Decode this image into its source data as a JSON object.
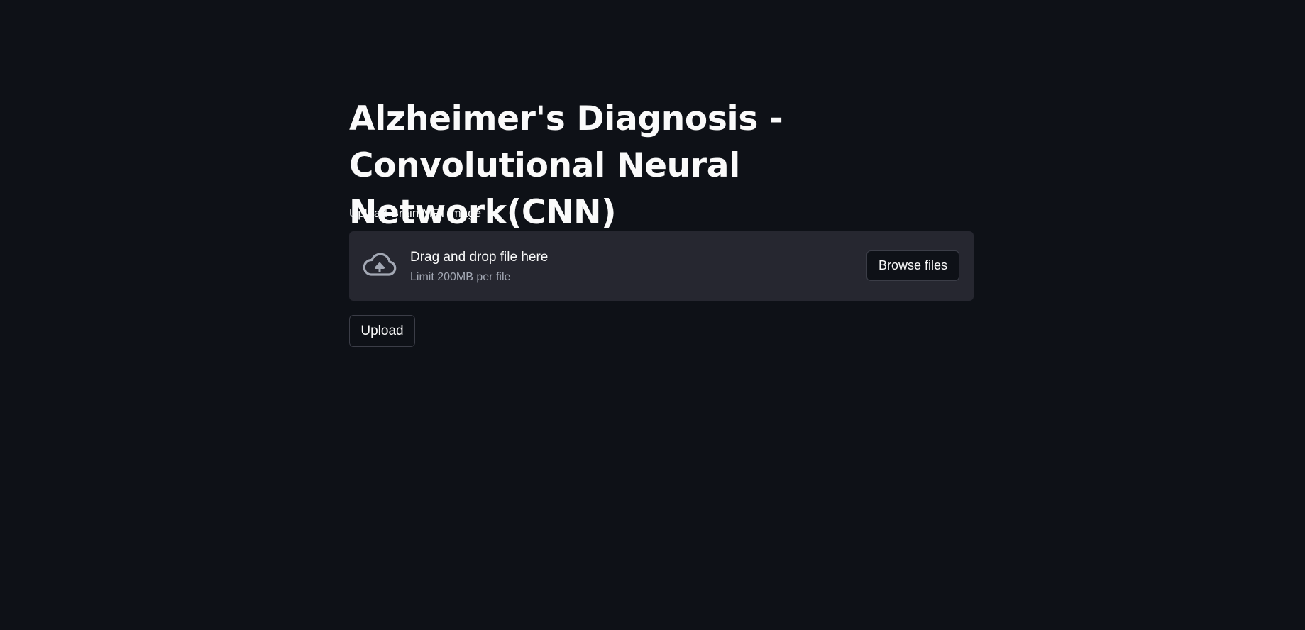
{
  "page": {
    "title_line1": "Alzheimer's Diagnosis -",
    "title_line2": "Convolutional Neural Network(CNN)"
  },
  "uploader": {
    "label": "Upload Brain MRI Image",
    "drop_text": "Drag and drop file here",
    "limit_text": "Limit 200MB per file",
    "browse_label": "Browse files",
    "icon": "cloud-upload-icon"
  },
  "actions": {
    "upload_label": "Upload"
  },
  "colors": {
    "background": "#0e1117",
    "dropzone": "#262730",
    "text": "#fafafa",
    "muted_text": "#a3a8b4",
    "button_border": "#3b3d47"
  }
}
